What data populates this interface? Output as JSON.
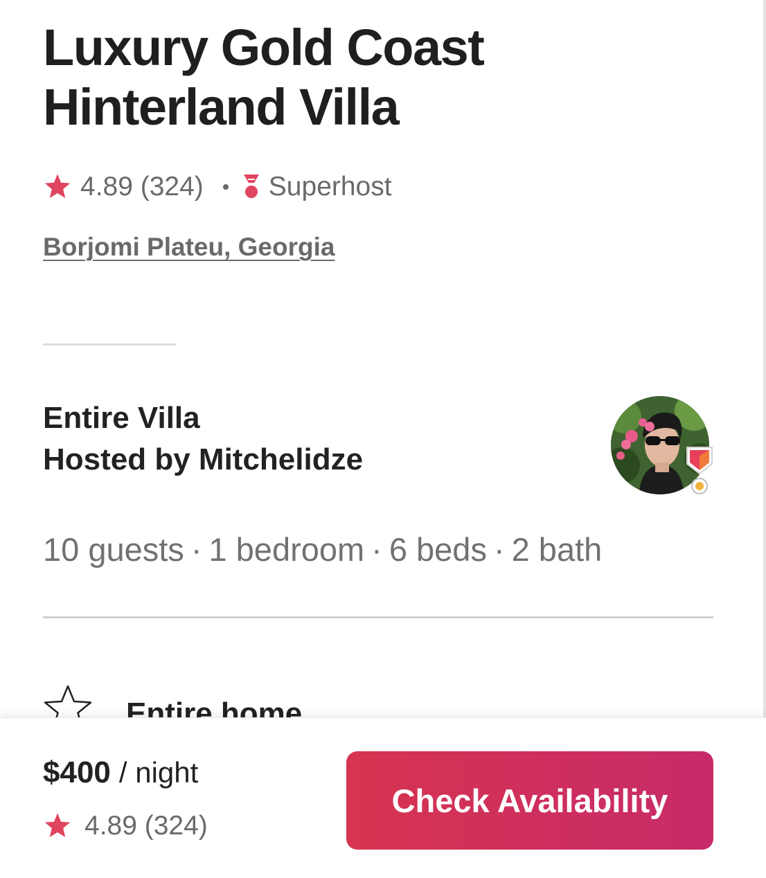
{
  "listing": {
    "title_line1": "Luxury Gold Coast",
    "title_line2": "Hinterland Villa",
    "rating": "4.89",
    "review_count": "(324)",
    "superhost_label": "Superhost",
    "location": "Borjomi Plateu, Georgia"
  },
  "host": {
    "property_type": "Entire Villa",
    "hosted_by": "Hosted by Mitchelidze"
  },
  "stats": {
    "guests": "10 guests",
    "bedrooms": "1 bedroom",
    "beds": "6 beds",
    "baths": "2 bath",
    "separator": "·"
  },
  "features": [
    {
      "title": "Entire home",
      "icon": "star-outline-icon"
    }
  ],
  "footer": {
    "price": "$400",
    "price_unit": "/ night",
    "rating": "4.89",
    "review_count": "(324)",
    "cta_label": "Check Availability"
  },
  "colors": {
    "accent": "#E0455F",
    "cta_gradient_start": "#D6344F",
    "cta_gradient_end": "#C72A69",
    "text_primary": "#222222",
    "text_secondary": "#717171"
  }
}
